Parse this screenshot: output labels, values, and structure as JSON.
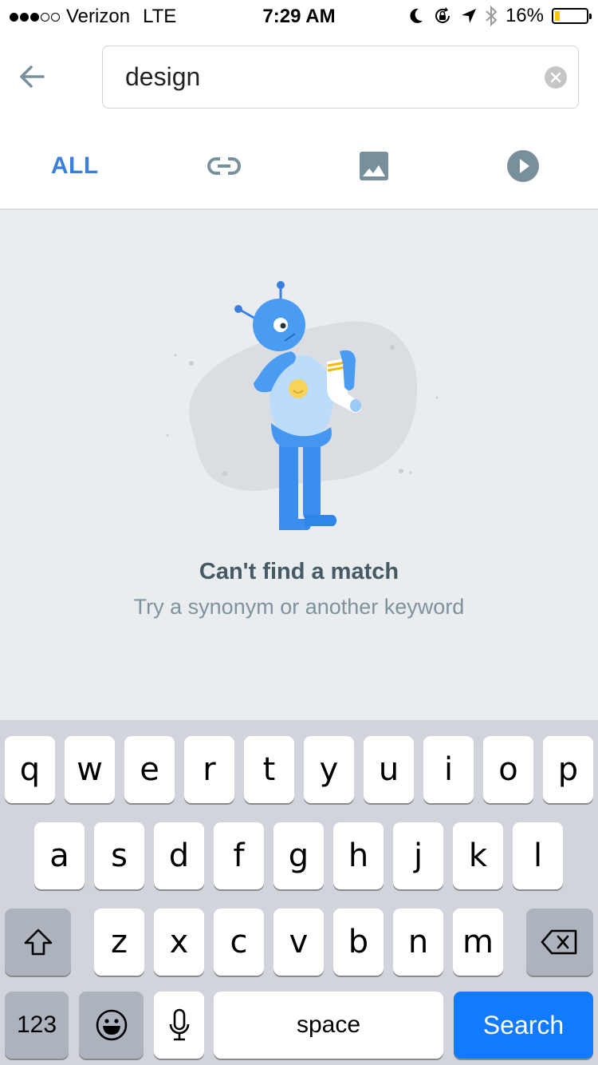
{
  "status_bar": {
    "signal_filled": 3,
    "signal_total": 5,
    "carrier": "Verizon",
    "network": "LTE",
    "time": "7:29 AM",
    "battery_percent_label": "16%",
    "battery_level": 0.16,
    "battery_color": "#f5c518",
    "icons": [
      "moon-icon",
      "rotation-lock-icon",
      "location-arrow-icon",
      "bluetooth-icon"
    ]
  },
  "search": {
    "value": "design",
    "back_icon": "arrow-left-icon",
    "clear_icon": "clear-circle-icon"
  },
  "filter_tabs": [
    {
      "label": "ALL",
      "type": "all",
      "active": true
    },
    {
      "label": "",
      "type": "links",
      "icon": "link-icon"
    },
    {
      "label": "",
      "type": "images",
      "icon": "image-icon"
    },
    {
      "label": "",
      "type": "videos",
      "icon": "play-circle-icon"
    }
  ],
  "colors": {
    "accent": "#3b7fdc",
    "icon_grey": "#78909c",
    "search_key": "#117aff"
  },
  "empty_state": {
    "illustration": "alien-holding-sock",
    "title": "Can't find a match",
    "subtitle": "Try a synonym or another keyword"
  },
  "keyboard": {
    "row1": [
      "q",
      "w",
      "e",
      "r",
      "t",
      "y",
      "u",
      "i",
      "o",
      "p"
    ],
    "row2": [
      "a",
      "s",
      "d",
      "f",
      "g",
      "h",
      "j",
      "k",
      "l"
    ],
    "row3": [
      "z",
      "x",
      "c",
      "v",
      "b",
      "n",
      "m"
    ],
    "numbers_label": "123",
    "space_label": "space",
    "search_label": "Search",
    "shift_icon": "shift-icon",
    "backspace_icon": "backspace-icon",
    "emoji_icon": "emoji-icon",
    "mic_icon": "microphone-icon"
  }
}
